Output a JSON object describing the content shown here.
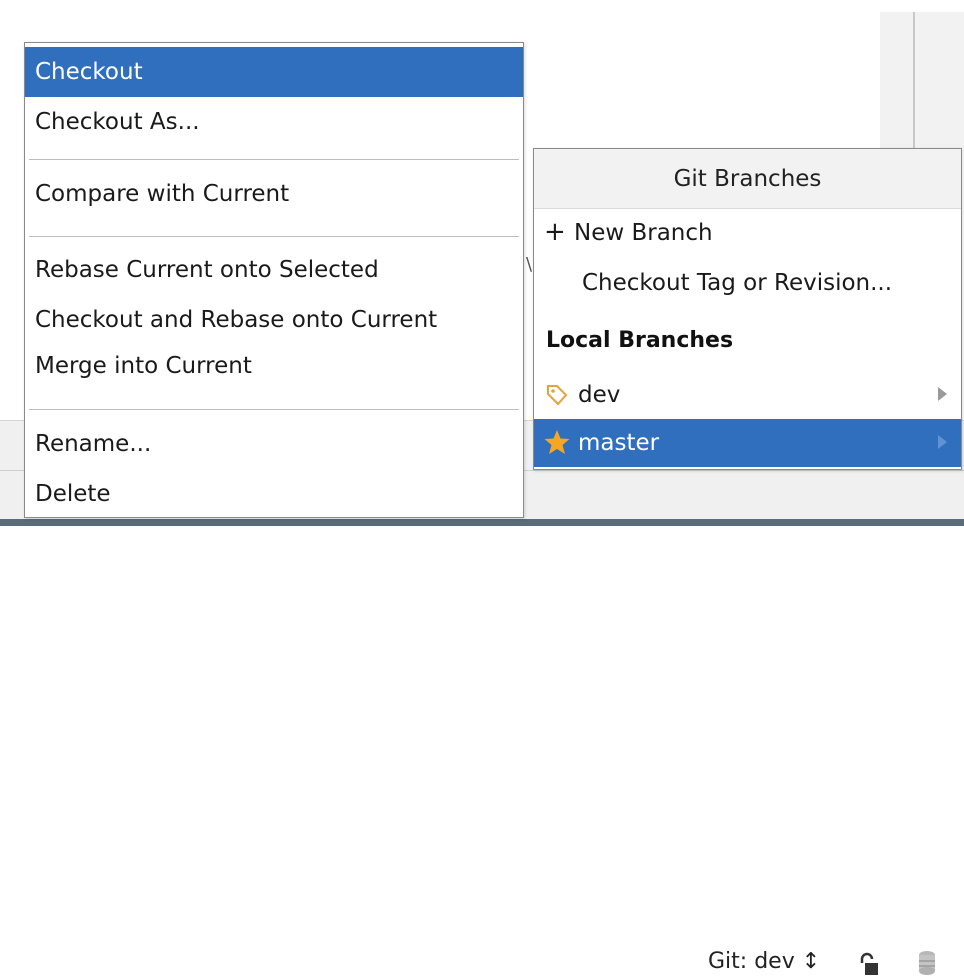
{
  "context_menu": {
    "items": [
      {
        "label": "Checkout",
        "selected": true
      },
      {
        "label": "Checkout As..."
      },
      {
        "label": "Compare with Current"
      },
      {
        "label": "Rebase Current onto Selected"
      },
      {
        "label": "Checkout and Rebase onto Current"
      },
      {
        "label": "Merge into Current"
      },
      {
        "label": "Rename..."
      },
      {
        "label": "Delete"
      }
    ]
  },
  "branches_popup": {
    "title": "Git Branches",
    "new_branch_label": "New Branch",
    "checkout_tag_label": "Checkout Tag or Revision...",
    "local_header": "Local Branches",
    "branches": [
      {
        "name": "dev",
        "icon": "tag-icon"
      },
      {
        "name": "master",
        "icon": "star-icon",
        "selected": true
      }
    ]
  },
  "status_bar": {
    "git_label": "Git: dev ↕"
  },
  "colors": {
    "selection": "#2f6fbd",
    "tag": "#e8a23a",
    "star": "#f5a623"
  }
}
